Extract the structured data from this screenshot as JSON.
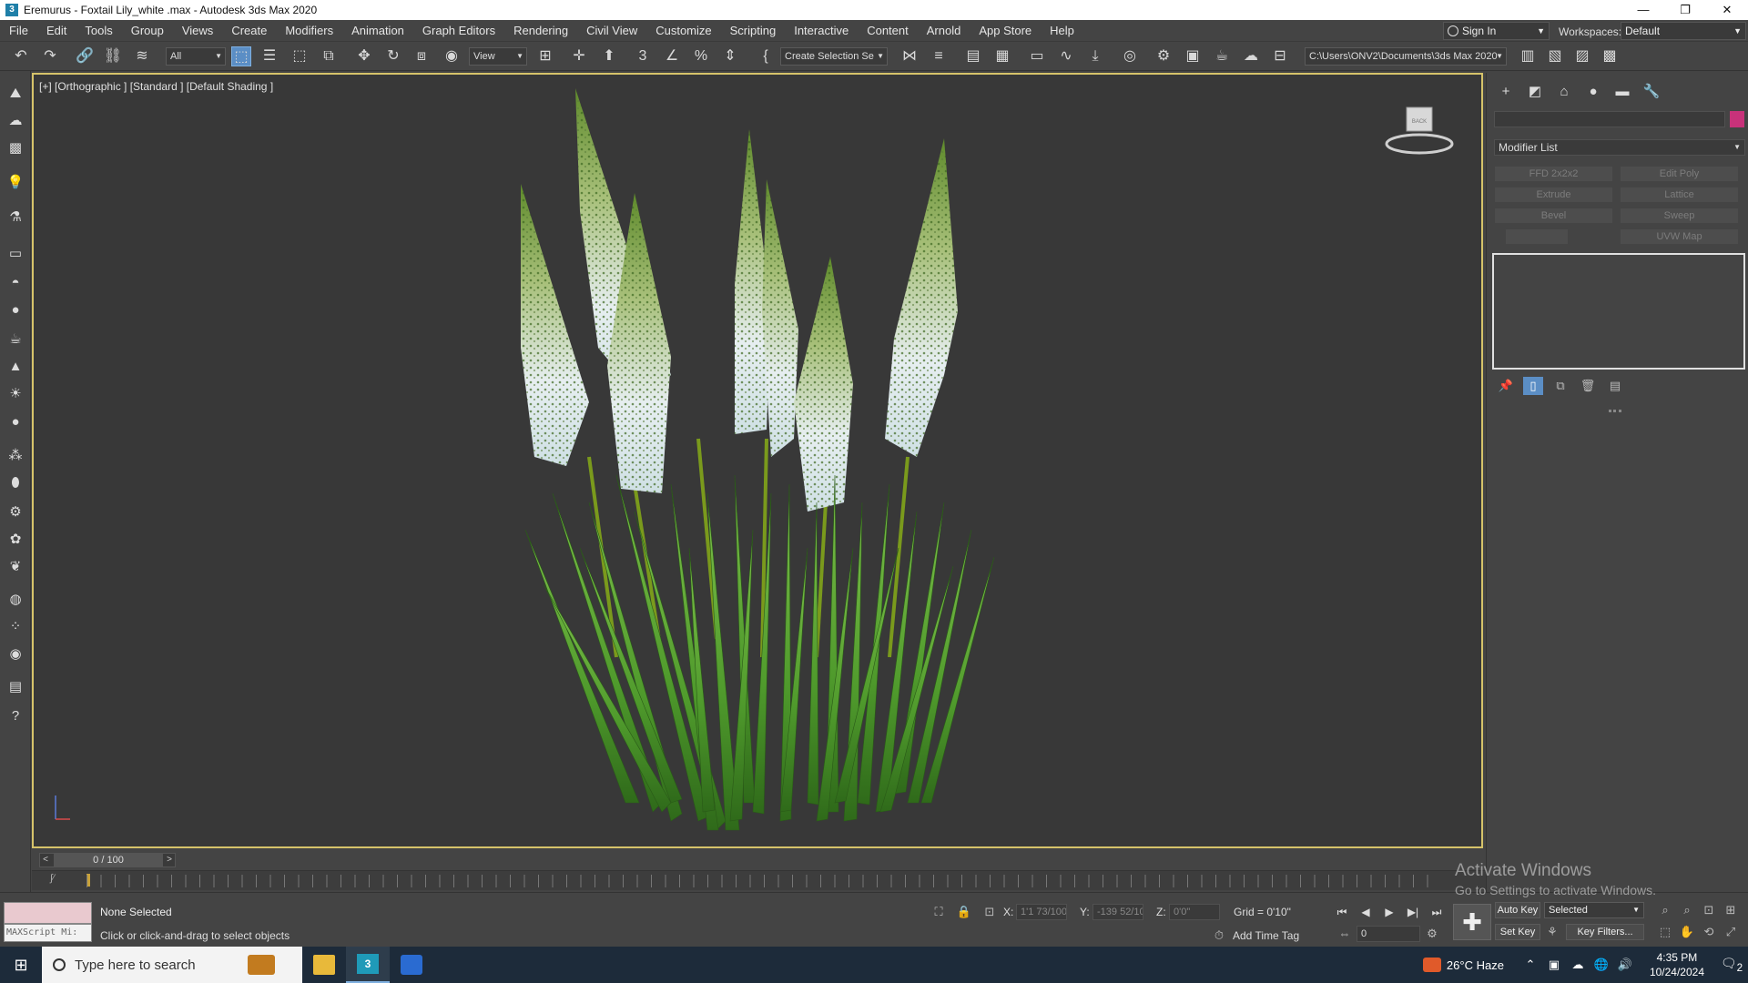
{
  "window": {
    "title": "Eremurus - Foxtail Lily_white .max - Autodesk 3ds Max 2020",
    "controls": [
      "—",
      "❐",
      "✕"
    ]
  },
  "menu": {
    "items": [
      "File",
      "Edit",
      "Tools",
      "Group",
      "Views",
      "Create",
      "Modifiers",
      "Animation",
      "Graph Editors",
      "Rendering",
      "Civil View",
      "Customize",
      "Scripting",
      "Interactive",
      "Content",
      "Arnold",
      "App Store",
      "Help"
    ],
    "sign_in": "Sign In",
    "workspaces_label": "Workspaces:",
    "workspace_value": "Default"
  },
  "toolbar": {
    "selection_filter": "All",
    "ref_coord": "View",
    "named_selection": "Create Selection Se",
    "project_path": "C:\\Users\\ONV2\\Documents\\3ds Max 2020"
  },
  "viewport": {
    "label": "[+] [Orthographic ] [Standard ] [Default Shading ]",
    "viewcube_face": "BACK"
  },
  "command_panel": {
    "modifier_list": "Modifier List",
    "modifier_buttons": [
      "FFD 2x2x2",
      "Edit Poly",
      "Extrude",
      "Lattice",
      "Bevel",
      "Sweep",
      "",
      "UVW Map"
    ]
  },
  "timeline": {
    "frame_indicator": "0 / 100",
    "prev": "<",
    "next": ">"
  },
  "status": {
    "maxscript_placeholder": "MAXScript Mi:",
    "selection": "None Selected",
    "prompt": "Click or click-and-drag to select objects",
    "x_label": "X:",
    "x_value": "1'1 73/100'",
    "y_label": "Y:",
    "y_value": "-139 52/10",
    "z_label": "Z:",
    "z_value": "0'0\"",
    "grid": "Grid = 0'10\"",
    "add_time_tag": "Add Time Tag",
    "frame_value": "0",
    "auto_key": "Auto Key",
    "key_mode": "Selected",
    "set_key": "Set Key",
    "key_filters": "Key Filters..."
  },
  "watermark": {
    "line1": "Activate Windows",
    "line2": "Go to Settings to activate Windows."
  },
  "taskbar": {
    "search_placeholder": "Type here to search",
    "weather": "26°C  Haze",
    "time": "4:35 PM",
    "date": "10/24/2024",
    "notification_count": "2"
  }
}
